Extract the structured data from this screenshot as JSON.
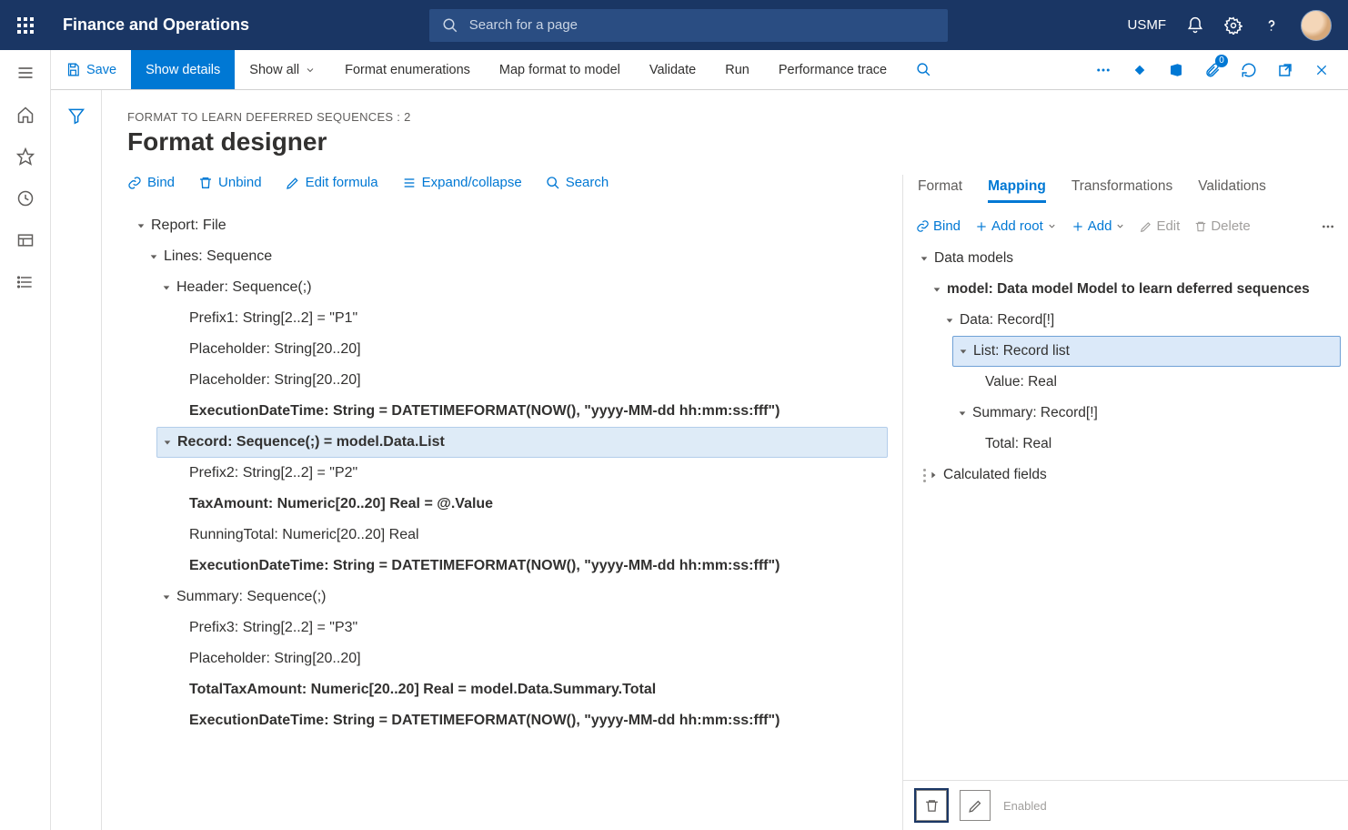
{
  "header": {
    "app_title": "Finance and Operations",
    "search_placeholder": "Search for a page",
    "company": "USMF"
  },
  "actionbar": {
    "save": "Save",
    "show_details": "Show details",
    "show_all": "Show all",
    "format_enum": "Format enumerations",
    "map_format": "Map format to model",
    "validate": "Validate",
    "run": "Run",
    "perf_trace": "Performance trace",
    "badge_count": "0"
  },
  "page": {
    "breadcrumb": "FORMAT TO LEARN DEFERRED SEQUENCES : 2",
    "title": "Format designer"
  },
  "left_toolbar": {
    "bind": "Bind",
    "unbind": "Unbind",
    "edit_formula": "Edit formula",
    "expand": "Expand/collapse",
    "search": "Search"
  },
  "left_tree": [
    {
      "indent": 0,
      "caret": "down",
      "bold": false,
      "text": "Report: File"
    },
    {
      "indent": 1,
      "caret": "down",
      "bold": false,
      "text": "Lines: Sequence"
    },
    {
      "indent": 2,
      "caret": "down",
      "bold": false,
      "text": "Header: Sequence(;)"
    },
    {
      "indent": 3,
      "caret": "",
      "bold": false,
      "text": "Prefix1: String[2..2] = \"P1\""
    },
    {
      "indent": 3,
      "caret": "",
      "bold": false,
      "text": "Placeholder: String[20..20]"
    },
    {
      "indent": 3,
      "caret": "",
      "bold": false,
      "text": "Placeholder: String[20..20]"
    },
    {
      "indent": 3,
      "caret": "",
      "bold": true,
      "text": "ExecutionDateTime: String = DATETIMEFORMAT(NOW(), \"yyyy-MM-dd hh:mm:ss:fff\")"
    },
    {
      "indent": 2,
      "caret": "down",
      "bold": true,
      "selected": true,
      "text": "Record: Sequence(;) = model.Data.List"
    },
    {
      "indent": 3,
      "caret": "",
      "bold": false,
      "text": "Prefix2: String[2..2] = \"P2\""
    },
    {
      "indent": 3,
      "caret": "",
      "bold": true,
      "text": "TaxAmount: Numeric[20..20] Real = @.Value"
    },
    {
      "indent": 3,
      "caret": "",
      "bold": false,
      "text": "RunningTotal: Numeric[20..20] Real"
    },
    {
      "indent": 3,
      "caret": "",
      "bold": true,
      "text": "ExecutionDateTime: String = DATETIMEFORMAT(NOW(), \"yyyy-MM-dd hh:mm:ss:fff\")"
    },
    {
      "indent": 2,
      "caret": "down",
      "bold": false,
      "text": "Summary: Sequence(;)"
    },
    {
      "indent": 3,
      "caret": "",
      "bold": false,
      "text": "Prefix3: String[2..2] = \"P3\""
    },
    {
      "indent": 3,
      "caret": "",
      "bold": false,
      "text": "Placeholder: String[20..20]"
    },
    {
      "indent": 3,
      "caret": "",
      "bold": true,
      "text": "TotalTaxAmount: Numeric[20..20] Real = model.Data.Summary.Total"
    },
    {
      "indent": 3,
      "caret": "",
      "bold": true,
      "text": "ExecutionDateTime: String = DATETIMEFORMAT(NOW(), \"yyyy-MM-dd hh:mm:ss:fff\")"
    }
  ],
  "right": {
    "tabs": {
      "format": "Format",
      "mapping": "Mapping",
      "transformations": "Transformations",
      "validations": "Validations"
    },
    "toolbar": {
      "bind": "Bind",
      "add_root": "Add root",
      "add": "Add",
      "edit": "Edit",
      "delete": "Delete"
    },
    "tree": [
      {
        "indent": 0,
        "caret": "down",
        "bold": false,
        "text": "Data models"
      },
      {
        "indent": 1,
        "caret": "down",
        "bold": true,
        "text": "model: Data model Model to learn deferred sequences"
      },
      {
        "indent": 2,
        "caret": "down",
        "bold": false,
        "text": "Data: Record[!]"
      },
      {
        "indent": 3,
        "caret": "down",
        "bold": false,
        "selected": true,
        "text": "List: Record list"
      },
      {
        "indent": 4,
        "caret": "",
        "bold": false,
        "text": "Value: Real"
      },
      {
        "indent": 3,
        "caret": "down",
        "bold": false,
        "text": "Summary: Record[!]"
      },
      {
        "indent": 4,
        "caret": "",
        "bold": false,
        "text": "Total: Real"
      },
      {
        "indent": 0,
        "caret": "right",
        "bold": false,
        "grip": true,
        "text": "Calculated fields"
      }
    ],
    "bottom": {
      "enabled": "Enabled"
    }
  }
}
